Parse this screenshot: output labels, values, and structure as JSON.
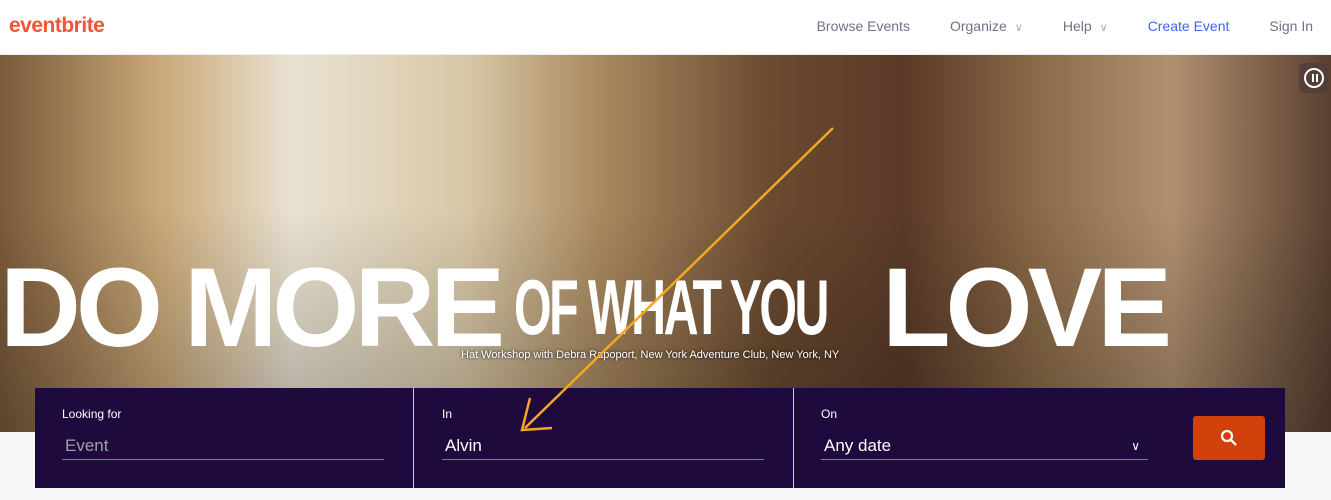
{
  "header": {
    "logo": "eventbrite",
    "nav": {
      "browse": "Browse Events",
      "organize": "Organize",
      "help": "Help",
      "create": "Create Event",
      "signin": "Sign In"
    }
  },
  "hero": {
    "headline": [
      "DO MORE",
      "OF",
      "WHAT YOU",
      "LOVE"
    ],
    "caption": "Hat Workshop with Debra Rapoport, New York Adventure Club, New York, NY",
    "pause_icon": "pause-icon"
  },
  "search": {
    "looking_for": {
      "label": "Looking for",
      "placeholder": "Event",
      "value": ""
    },
    "in": {
      "label": "In",
      "value": "Alvin"
    },
    "on": {
      "label": "On",
      "value": "Any date"
    },
    "button_icon": "search-icon"
  },
  "colors": {
    "brand": "#f05537",
    "search_bg": "#1e0a3c",
    "search_button": "#d1410c",
    "link": "#3d64ff",
    "annotation_arrow": "#f5a623"
  }
}
